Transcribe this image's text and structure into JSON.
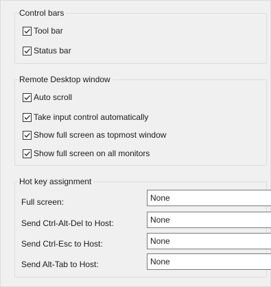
{
  "control_bars": {
    "title": "Control bars",
    "items": [
      {
        "label": "Tool bar",
        "checked": true
      },
      {
        "label": "Status bar",
        "checked": true
      }
    ]
  },
  "remote_desktop_window": {
    "title": "Remote Desktop window",
    "items": [
      {
        "label": "Auto scroll",
        "checked": true
      },
      {
        "label": "Take input control automatically",
        "checked": true
      },
      {
        "label": "Show full screen as topmost window",
        "checked": true
      },
      {
        "label": "Show full screen on all monitors",
        "checked": true
      }
    ]
  },
  "hot_key_assignment": {
    "title": "Hot key assignment",
    "rows": [
      {
        "label": "Full screen:",
        "value": "None"
      },
      {
        "label": "Send Ctrl-Alt-Del to Host:",
        "value": "None"
      },
      {
        "label": "Send Ctrl-Esc to Host:",
        "value": "None"
      },
      {
        "label": "Send Alt-Tab to Host:",
        "value": "None"
      }
    ]
  }
}
